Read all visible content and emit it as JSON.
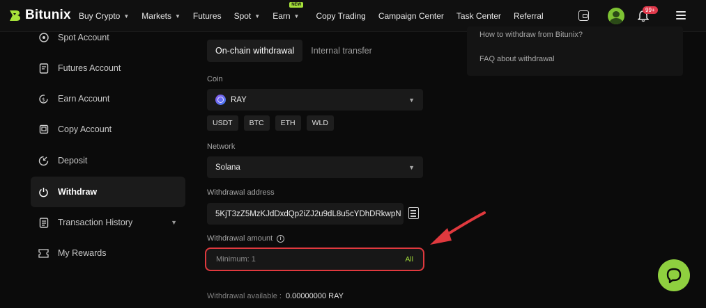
{
  "brand": {
    "name": "Bitunix",
    "accent": "#a6e13a"
  },
  "nav": {
    "items": [
      {
        "label": "Buy Crypto",
        "dropdown": true
      },
      {
        "label": "Markets",
        "dropdown": true
      },
      {
        "label": "Futures",
        "dropdown": false
      },
      {
        "label": "Spot",
        "dropdown": true
      },
      {
        "label": "Earn",
        "dropdown": true,
        "badge": "NEW"
      },
      {
        "label": "Copy Trading",
        "dropdown": false
      },
      {
        "label": "Campaign Center",
        "dropdown": false
      },
      {
        "label": "Task Center",
        "dropdown": false
      },
      {
        "label": "Referral",
        "dropdown": false
      }
    ],
    "notification_count": "99+"
  },
  "sidebar": {
    "items": [
      {
        "label": "Spot Account",
        "icon": "target-icon"
      },
      {
        "label": "Futures Account",
        "icon": "document-icon"
      },
      {
        "label": "Earn Account",
        "icon": "coin-icon"
      },
      {
        "label": "Copy Account",
        "icon": "copy-icon"
      },
      {
        "label": "Deposit",
        "icon": "deposit-icon"
      },
      {
        "label": "Withdraw",
        "icon": "power-icon",
        "active": true
      },
      {
        "label": "Transaction History",
        "icon": "history-icon",
        "expandable": true
      },
      {
        "label": "My Rewards",
        "icon": "ticket-icon"
      }
    ]
  },
  "withdraw": {
    "tabs": [
      "On-chain withdrawal",
      "Internal transfer"
    ],
    "coin_label": "Coin",
    "coin_value": "RAY",
    "quick_coins": [
      "USDT",
      "BTC",
      "ETH",
      "WLD"
    ],
    "network_label": "Network",
    "network_value": "Solana",
    "address_label": "Withdrawal address",
    "address_value": "5KjT3zZ5MzKJdDxdQp2iZJ2u9dL8u5cYDhDRkwpN",
    "amount_label": "Withdrawal amount",
    "amount_placeholder": "Minimum: 1",
    "all_label": "All",
    "available_label": "Withdrawal available :",
    "available_value": "0.00000000 RAY"
  },
  "faq": {
    "links": [
      "How to withdraw from Bitunix?",
      "FAQ about withdrawal"
    ]
  },
  "colors": {
    "highlight": "#e0393e",
    "chat": "#8fd03f"
  }
}
